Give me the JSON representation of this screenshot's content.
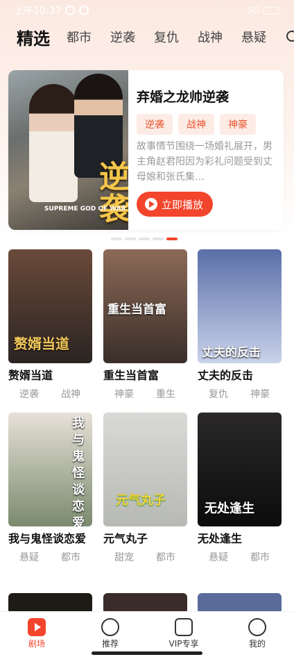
{
  "status_bar": {
    "time": "上午10:37",
    "network": "5G"
  },
  "tabs": [
    "精选",
    "都市",
    "逆袭",
    "复仇",
    "战神",
    "悬疑"
  ],
  "featured": {
    "title": "弃婚之龙帅逆袭",
    "tags": [
      "逆袭",
      "战神",
      "神豪"
    ],
    "description": "故事情节围绕一场婚礼展开，男主角赵君阳因为彩礼问题受到丈母娘和张氏集…",
    "play_label": "立即播放",
    "poster_title": "逆袭",
    "poster_subtitle": "SUPREME GOD OF WAR"
  },
  "pager": {
    "count": 5,
    "active": 4
  },
  "dramas": [
    {
      "title": "赘婿当道",
      "tags": [
        "逆袭",
        "战神"
      ],
      "poster_text": "赘婿当道",
      "color_a": "#6b4a3a",
      "color_b": "#2a2422"
    },
    {
      "title": "重生当首富",
      "tags": [
        "神豪",
        "重生"
      ],
      "poster_text": "重生当首富",
      "color_a": "#8c6a56",
      "color_b": "#3a2e2a"
    },
    {
      "title": "丈夫的反击",
      "tags": [
        "复仇",
        "神豪"
      ],
      "poster_text": "丈夫的反击",
      "color_a": "#5a6fa8",
      "color_b": "#c9d2ea"
    },
    {
      "title": "我与鬼怪谈恋爱",
      "tags": [
        "悬疑",
        "都市"
      ],
      "poster_text": "我与鬼怪谈恋爱",
      "color_a": "#e7e1d8",
      "color_b": "#7a8a6e"
    },
    {
      "title": "元气丸子",
      "tags": [
        "甜宠",
        "都市"
      ],
      "poster_text": "元气丸子",
      "color_a": "#d9dad6",
      "color_b": "#b7b9b4"
    },
    {
      "title": "无处逢生",
      "tags": [
        "悬疑",
        "都市"
      ],
      "poster_text": "无处逢生",
      "color_a": "#2a2828",
      "color_b": "#0c0c0c"
    }
  ],
  "nav": {
    "items": [
      "剧场",
      "推荐",
      "VIP专享",
      "我的"
    ]
  },
  "colors": {
    "accent": "#f2452c"
  }
}
